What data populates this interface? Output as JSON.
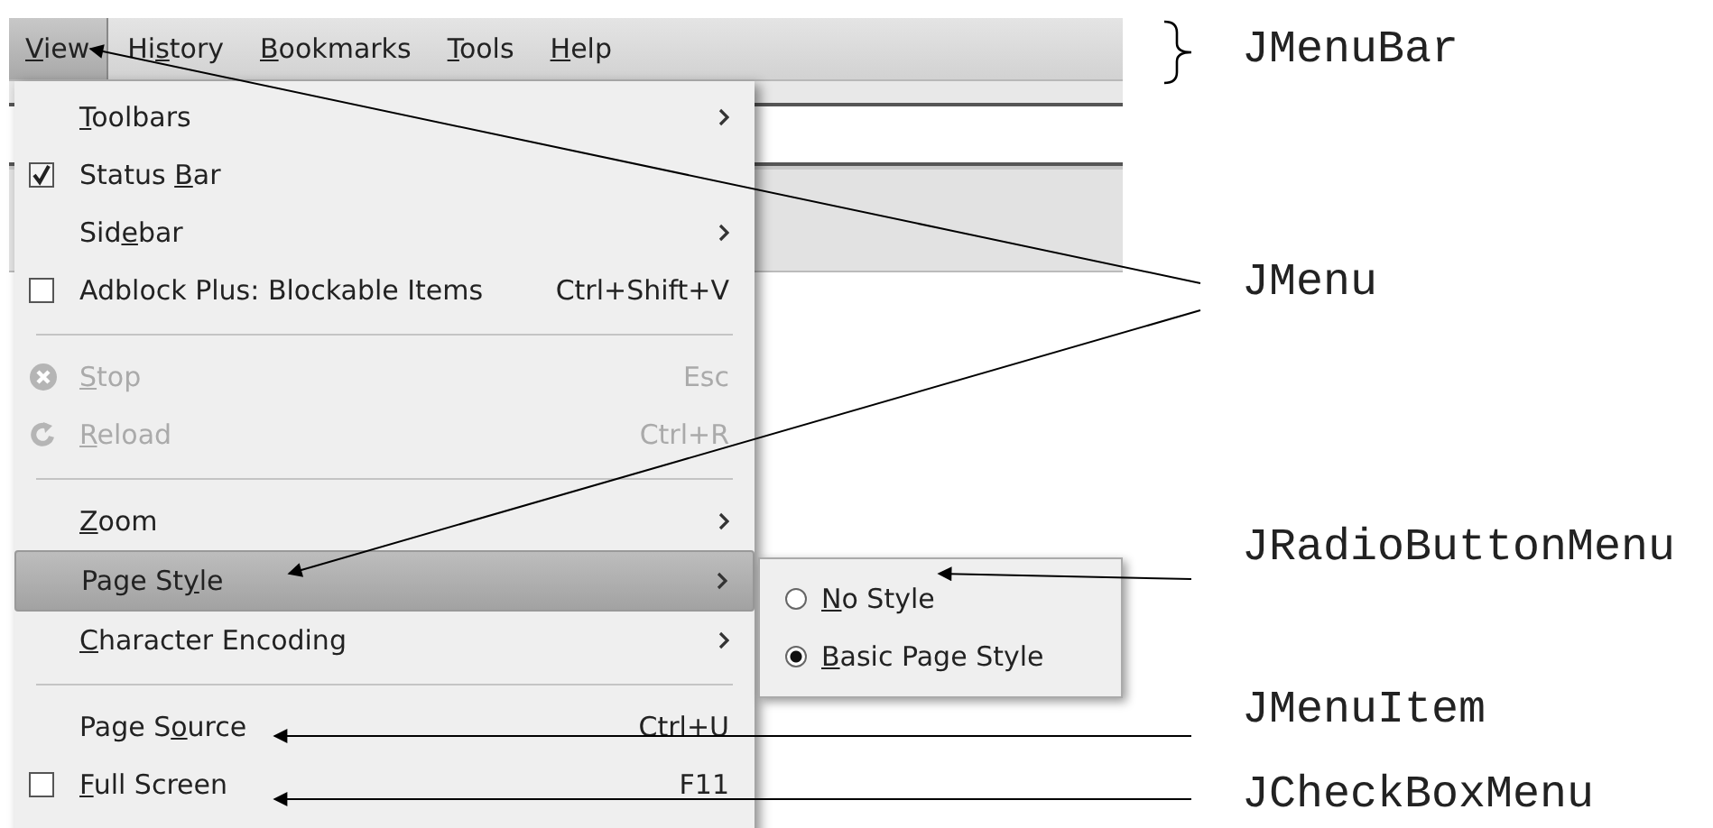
{
  "menu_bar": {
    "items": [
      {
        "label": [
          {
            "text": "V",
            "underline": true
          },
          {
            "text": "iew",
            "underline": false
          }
        ],
        "selected": true
      },
      {
        "label": [
          {
            "text": "Hi",
            "underline": false
          },
          {
            "text": "s",
            "underline": true
          },
          {
            "text": "tory",
            "underline": false
          }
        ],
        "selected": false
      },
      {
        "label": [
          {
            "text": "B",
            "underline": true
          },
          {
            "text": "ookmarks",
            "underline": false
          }
        ],
        "selected": false
      },
      {
        "label": [
          {
            "text": "T",
            "underline": true
          },
          {
            "text": "ools",
            "underline": false
          }
        ],
        "selected": false
      },
      {
        "label": [
          {
            "text": "H",
            "underline": true
          },
          {
            "text": "elp",
            "underline": false
          }
        ],
        "selected": false
      }
    ]
  },
  "view_menu": {
    "items": [
      {
        "kind": "submenu",
        "label": [
          {
            "text": "T",
            "underline": true
          },
          {
            "text": "oolbars",
            "underline": false
          }
        ],
        "disabled": false,
        "selected": false
      },
      {
        "kind": "checkbox",
        "label": [
          {
            "text": "Status ",
            "underline": false
          },
          {
            "text": "B",
            "underline": true
          },
          {
            "text": "ar",
            "underline": false
          }
        ],
        "checked": true,
        "disabled": false,
        "selected": false
      },
      {
        "kind": "submenu",
        "label": [
          {
            "text": "Sid",
            "underline": false
          },
          {
            "text": "e",
            "underline": true
          },
          {
            "text": "bar",
            "underline": false
          }
        ],
        "disabled": false,
        "selected": false
      },
      {
        "kind": "checkbox",
        "label": [
          {
            "text": "Adblock Plus: Blockable Items",
            "underline": false
          }
        ],
        "shortcut": "Ctrl+Shift+V",
        "checked": false,
        "disabled": false,
        "selected": false
      },
      {
        "kind": "separator"
      },
      {
        "kind": "stop",
        "label": [
          {
            "text": "S",
            "underline": true
          },
          {
            "text": "top",
            "underline": false
          }
        ],
        "shortcut": "Esc",
        "disabled": true,
        "selected": false
      },
      {
        "kind": "reload",
        "label": [
          {
            "text": "R",
            "underline": true
          },
          {
            "text": "eload",
            "underline": false
          }
        ],
        "shortcut": "Ctrl+R",
        "disabled": true,
        "selected": false
      },
      {
        "kind": "separator"
      },
      {
        "kind": "submenu",
        "label": [
          {
            "text": "Z",
            "underline": true
          },
          {
            "text": "oom",
            "underline": false
          }
        ],
        "disabled": false,
        "selected": false
      },
      {
        "kind": "submenu",
        "label": [
          {
            "text": "Page St",
            "underline": false
          },
          {
            "text": "y",
            "underline": true
          },
          {
            "text": "le",
            "underline": false
          }
        ],
        "disabled": false,
        "selected": true
      },
      {
        "kind": "submenu",
        "label": [
          {
            "text": "C",
            "underline": true
          },
          {
            "text": "haracter Encoding",
            "underline": false
          }
        ],
        "disabled": false,
        "selected": false
      },
      {
        "kind": "separator"
      },
      {
        "kind": "command",
        "label": [
          {
            "text": "Page S",
            "underline": false
          },
          {
            "text": "o",
            "underline": true
          },
          {
            "text": "urce",
            "underline": false
          }
        ],
        "shortcut": "Ctrl+U",
        "disabled": false,
        "selected": false
      },
      {
        "kind": "checkbox",
        "label": [
          {
            "text": "F",
            "underline": true
          },
          {
            "text": "ull Screen",
            "underline": false
          }
        ],
        "shortcut": "F11",
        "checked": false,
        "disabled": false,
        "selected": false
      }
    ]
  },
  "page_style_submenu": {
    "items": [
      {
        "label": [
          {
            "text": "N",
            "underline": true
          },
          {
            "text": "o Style",
            "underline": false
          }
        ],
        "selected": false
      },
      {
        "label": [
          {
            "text": "B",
            "underline": true
          },
          {
            "text": "asic Page Style",
            "underline": false
          }
        ],
        "selected": true
      }
    ]
  },
  "annotations": [
    {
      "kind": "brace",
      "label": "JMenuBar"
    },
    {
      "kind": "double",
      "label": "JMenu"
    },
    {
      "kind": "arrow",
      "label": "JRadioButtonMenu"
    },
    {
      "kind": "arrow",
      "label": "JMenuItem"
    },
    {
      "kind": "arrow",
      "label": "JCheckBoxMenu"
    }
  ]
}
